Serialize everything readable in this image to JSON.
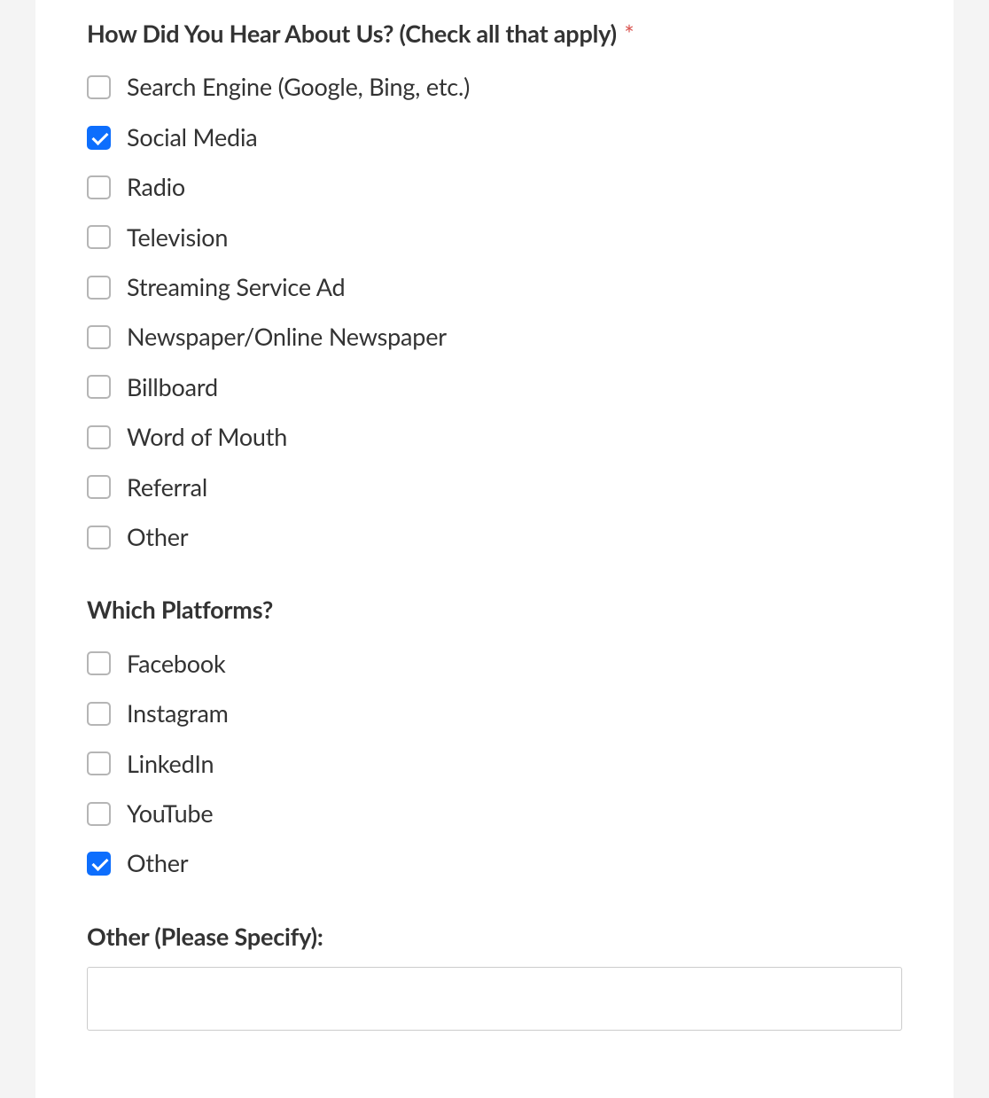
{
  "questions": {
    "hear": {
      "label": "How Did You Hear About Us? (Check all that apply)",
      "required": true,
      "options": [
        {
          "label": "Search Engine (Google, Bing, etc.)",
          "checked": false
        },
        {
          "label": "Social Media",
          "checked": true
        },
        {
          "label": "Radio",
          "checked": false
        },
        {
          "label": "Television",
          "checked": false
        },
        {
          "label": "Streaming Service Ad",
          "checked": false
        },
        {
          "label": "Newspaper/Online Newspaper",
          "checked": false
        },
        {
          "label": "Billboard",
          "checked": false
        },
        {
          "label": "Word of Mouth",
          "checked": false
        },
        {
          "label": "Referral",
          "checked": false
        },
        {
          "label": "Other",
          "checked": false
        }
      ]
    },
    "platforms": {
      "label": "Which Platforms?",
      "required": false,
      "options": [
        {
          "label": "Facebook",
          "checked": false
        },
        {
          "label": "Instagram",
          "checked": false
        },
        {
          "label": "LinkedIn",
          "checked": false
        },
        {
          "label": "YouTube",
          "checked": false
        },
        {
          "label": "Other",
          "checked": true
        }
      ]
    },
    "other_specify": {
      "label": "Other (Please Specify):",
      "value": ""
    }
  },
  "required_asterisk": "*"
}
